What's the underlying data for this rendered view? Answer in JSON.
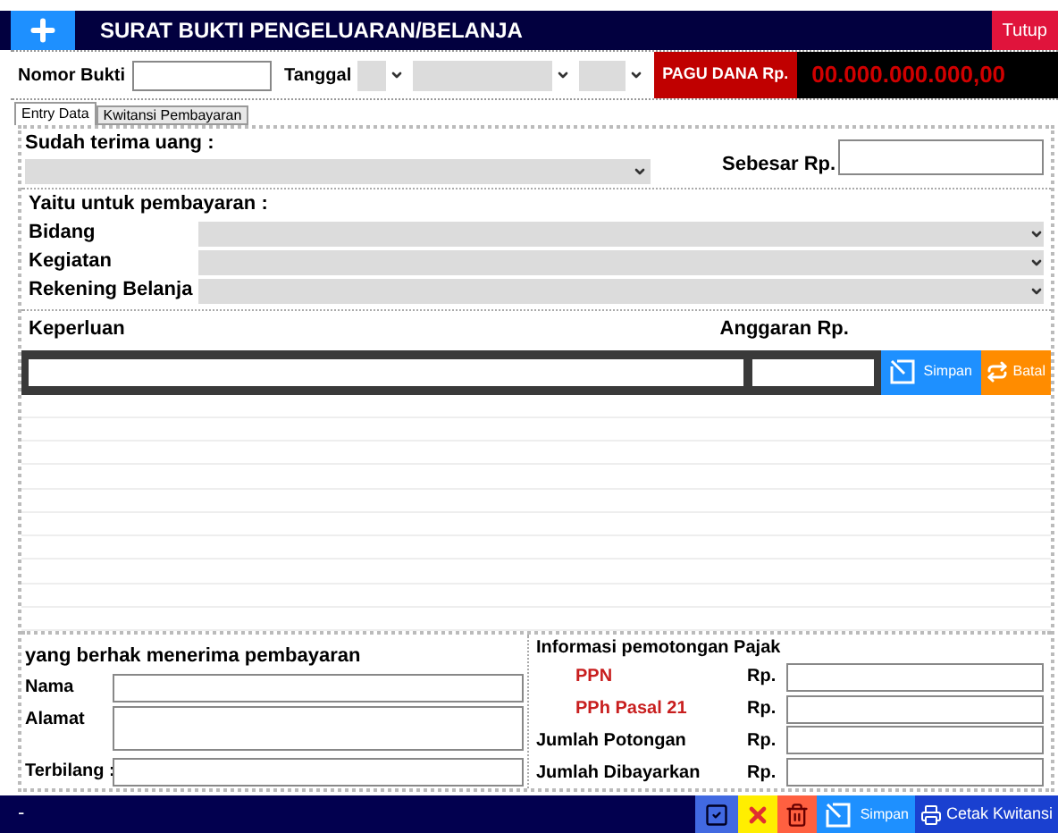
{
  "window": {
    "title": "SURAT BUKTI PENGELUARAN/BELANJA",
    "close_button": "Tutup"
  },
  "header": {
    "nomor_label": "Nomor Bukti",
    "tanggal_label": "Tanggal",
    "pagu_label": "PAGU DANA Rp.",
    "pagu_value": "00.000.000.000,00"
  },
  "tabs": [
    {
      "label": "Entry Data",
      "selected": true
    },
    {
      "label": "Kwitansi Pembayaran",
      "selected": false
    }
  ],
  "received": {
    "label": "Sudah terima uang :",
    "amount_label": "Sebesar Rp."
  },
  "payment": {
    "title": "Yaitu untuk pembayaran :",
    "fields": [
      {
        "label": "Bidang"
      },
      {
        "label": "Kegiatan"
      },
      {
        "label": "Rekening Belanja"
      }
    ]
  },
  "detail": {
    "purpose_label": "Keperluan",
    "budget_label": "Anggaran Rp.",
    "save_button": "Simpan",
    "cancel_button": "Batal"
  },
  "recipient": {
    "title": "yang berhak menerima pembayaran",
    "fields": [
      {
        "label": "Nama",
        "kind": "line"
      },
      {
        "label": "Alamat",
        "kind": "area"
      },
      {
        "label": "Terbilang :",
        "kind": "line"
      }
    ]
  },
  "tax": {
    "title": "Informasi pemotongan Pajak",
    "rows": [
      {
        "label": "PPN",
        "currency": "Rp.",
        "kind": "tax"
      },
      {
        "label": "PPh Pasal 21",
        "currency": "Rp.",
        "kind": "tax"
      },
      {
        "label": "Jumlah Potongan",
        "currency": "Rp.",
        "kind": "total"
      },
      {
        "label": "Jumlah Dibayarkan",
        "currency": "Rp.",
        "kind": "total"
      }
    ]
  },
  "status_bar": {
    "text": "-",
    "save_button": "Simpan",
    "print_button": "Cetak Kwitansi"
  }
}
